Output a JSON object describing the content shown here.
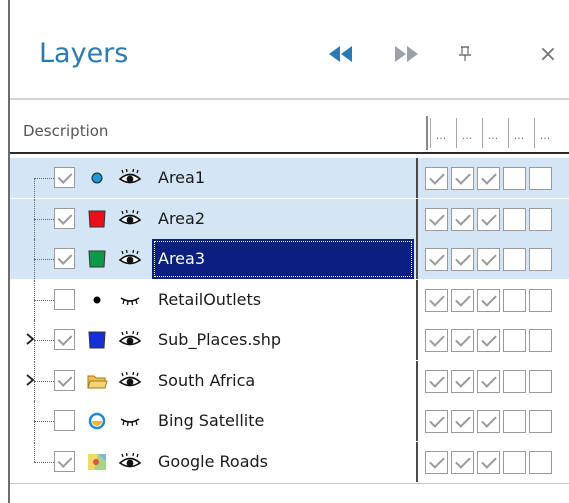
{
  "panel": {
    "title": "Layers",
    "buttons": {
      "prev_icon": "rewind-icon",
      "next_icon": "fast-forward-icon",
      "pin_icon": "pin-icon",
      "close_label": "×"
    },
    "accent": "#2a7ab4"
  },
  "header": {
    "description": "Description",
    "col1": "...",
    "col2": "...",
    "col3": "...",
    "col4": "...",
    "col5": "..."
  },
  "layers": [
    {
      "name": "Area1",
      "checked": true,
      "symbol": "blue-dot-icon",
      "visible": true,
      "selected": true,
      "current": false,
      "expander": false,
      "cols": [
        true,
        true,
        true,
        false,
        false
      ]
    },
    {
      "name": "Area2",
      "checked": true,
      "symbol": "red-swatch-icon",
      "visible": true,
      "selected": true,
      "current": false,
      "expander": false,
      "cols": [
        true,
        true,
        true,
        false,
        false
      ]
    },
    {
      "name": "Area3",
      "checked": true,
      "symbol": "green-swatch-icon",
      "visible": true,
      "selected": true,
      "current": true,
      "expander": false,
      "cols": [
        true,
        true,
        true,
        false,
        false
      ]
    },
    {
      "name": "RetailOutlets",
      "checked": false,
      "symbol": "black-dot-icon",
      "visible": false,
      "selected": false,
      "current": false,
      "expander": false,
      "cols": [
        true,
        true,
        true,
        false,
        false
      ]
    },
    {
      "name": "Sub_Places.shp",
      "checked": true,
      "symbol": "blue-swatch-icon",
      "visible": true,
      "selected": false,
      "current": false,
      "expander": true,
      "cols": [
        true,
        true,
        true,
        false,
        false
      ]
    },
    {
      "name": "South Africa",
      "checked": true,
      "symbol": "folder-icon",
      "visible": true,
      "selected": false,
      "current": false,
      "expander": true,
      "cols": [
        true,
        true,
        true,
        false,
        false
      ]
    },
    {
      "name": "Bing Satellite",
      "checked": false,
      "symbol": "bing-icon",
      "visible": false,
      "selected": false,
      "current": false,
      "expander": false,
      "cols": [
        true,
        true,
        true,
        false,
        false
      ]
    },
    {
      "name": "Google Roads",
      "checked": true,
      "symbol": "google-maps-icon",
      "visible": true,
      "selected": false,
      "current": false,
      "expander": false,
      "cols": [
        true,
        true,
        true,
        false,
        false
      ]
    }
  ]
}
